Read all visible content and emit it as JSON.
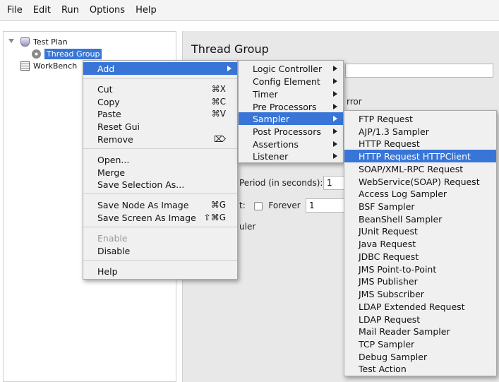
{
  "menubar": {
    "items": [
      "File",
      "Edit",
      "Run",
      "Options",
      "Help"
    ]
  },
  "tree": {
    "test_plan": "Test Plan",
    "thread_group": "Thread Group",
    "workbench": "WorkBench"
  },
  "right_panel": {
    "title": "Thread Group",
    "error_fragment": "rror",
    "period_label": "Period (in seconds):",
    "period_value": "1",
    "loop_prefix": "t:",
    "forever_label": "Forever",
    "loop_value": "1",
    "scheduler_fragment": "uler"
  },
  "context_menu": {
    "add": "Add",
    "cut": "Cut",
    "cut_sc": "⌘X",
    "copy": "Copy",
    "copy_sc": "⌘C",
    "paste": "Paste",
    "paste_sc": "⌘V",
    "reset_gui": "Reset Gui",
    "remove": "Remove",
    "remove_sc": "⌦",
    "open": "Open...",
    "merge": "Merge",
    "save_selection": "Save Selection As...",
    "save_node": "Save Node As Image",
    "save_node_sc": "⌘G",
    "save_screen": "Save Screen As Image",
    "save_screen_sc": "⇧⌘G",
    "enable": "Enable",
    "disable": "Disable",
    "help": "Help"
  },
  "add_submenu": {
    "items": [
      "Logic Controller",
      "Config Element",
      "Timer",
      "Pre Processors",
      "Sampler",
      "Post Processors",
      "Assertions",
      "Listener"
    ],
    "highlighted": "Sampler"
  },
  "sampler_submenu": {
    "items": [
      "FTP Request",
      "AJP/1.3 Sampler",
      "HTTP Request",
      "HTTP Request HTTPClient",
      "SOAP/XML-RPC Request",
      "WebService(SOAP) Request",
      "Access Log Sampler",
      "BSF Sampler",
      "BeanShell Sampler",
      "JUnit Request",
      "Java Request",
      "JDBC Request",
      "JMS Point-to-Point",
      "JMS Publisher",
      "JMS Subscriber",
      "LDAP Extended Request",
      "LDAP Request",
      "Mail Reader Sampler",
      "TCP Sampler",
      "Debug Sampler",
      "Test Action"
    ],
    "highlighted": "HTTP Request HTTPClient"
  },
  "colors": {
    "highlight": "#3875d7",
    "menu_bg": "#f0f0f0"
  }
}
